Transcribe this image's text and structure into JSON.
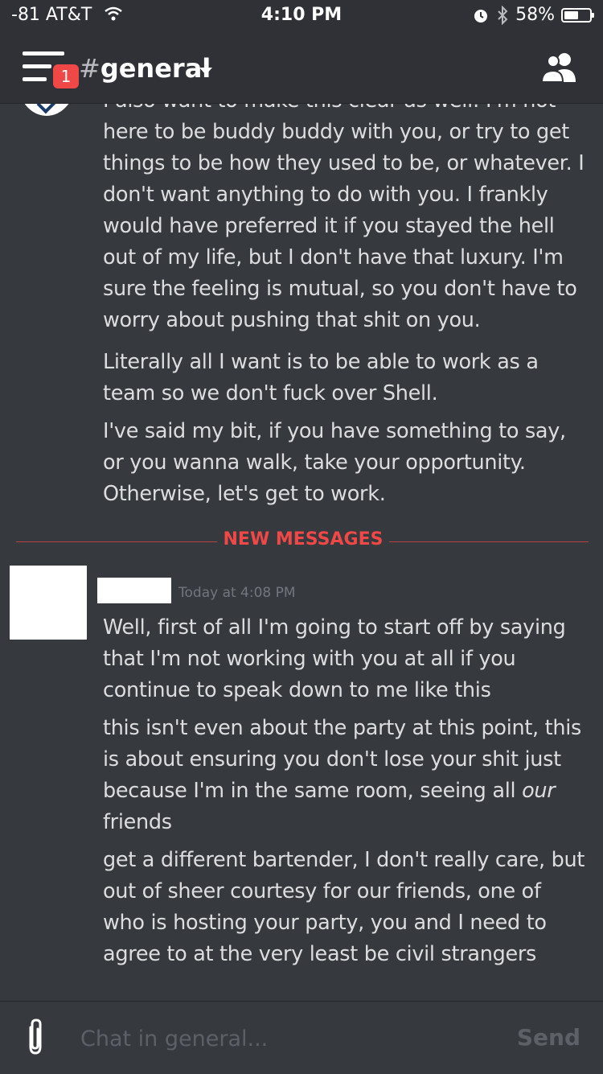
{
  "status_bar": {
    "carrier": "-81 AT&T",
    "time": "4:10 PM",
    "battery": "58%",
    "battery_level": 0.58
  },
  "header": {
    "hash": "#",
    "channel": "general",
    "unread_badge": "1"
  },
  "messages": {
    "previous": {
      "paragraphs": [
        "I also want to make this clear as well: I'm not here to be buddy buddy with you, or try to get things to be how they used to be, or whatever. I don't want anything to do with you. I frankly would have preferred it if you stayed the hell out of my life, but I don't have that luxury. I'm sure the feeling is mutual, so you don't have to worry about pushing that shit on you.",
        "Literally all I want is to be able to work as a team so we don't fuck over Shell.",
        "I've said my bit, if you have something to say, or you wanna walk, take your opportunity. Otherwise, let's get to work."
      ]
    },
    "divider_label": "NEW MESSAGES",
    "new": {
      "timestamp": "Today at 4:08 PM",
      "paragraphs": [
        "Well, first of all I'm going to start off by saying that I'm not working with you at all if you continue to speak down to me like this",
        "this isn't even about the party at this point, this is about ensuring you don't lose your shit just because I'm in the same room, seeing all",
        "our",
        "friends",
        "get a different bartender, I don't really care, but out of sheer courtesy for our friends, one of who is hosting your party, you and I need to agree to at the very least be civil strangers"
      ]
    }
  },
  "composer": {
    "placeholder": "Chat in general...",
    "send_label": "Send"
  }
}
